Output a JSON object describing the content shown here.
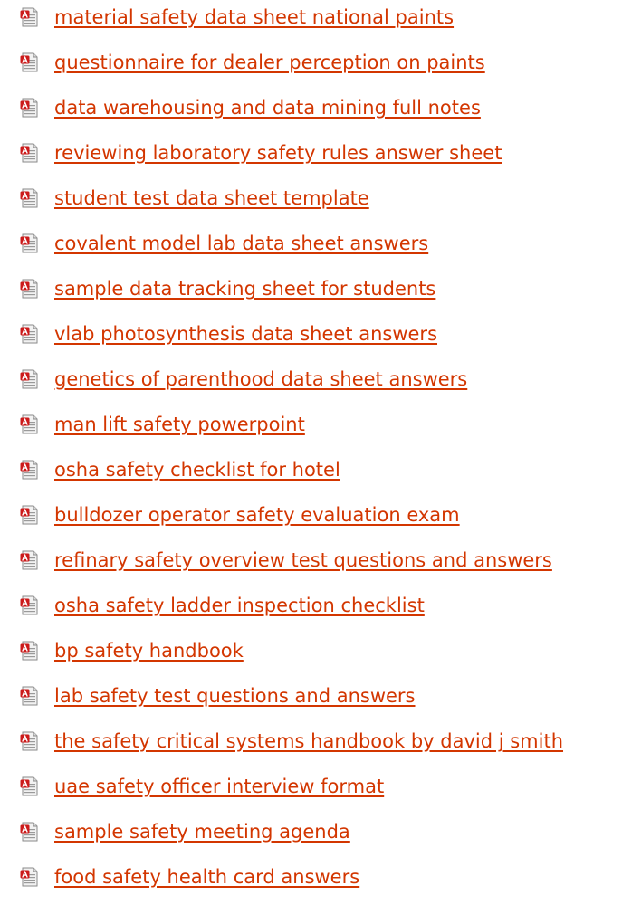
{
  "colors": {
    "link": "#d33600",
    "icon_red": "#cc1b1b",
    "icon_page": "#f2f2f2"
  },
  "icons": {
    "item_icon": "pdf-file-icon"
  },
  "links": [
    {
      "label": "material safety data sheet national paints"
    },
    {
      "label": "questionnaire for dealer perception on paints"
    },
    {
      "label": "data warehousing and data mining full notes"
    },
    {
      "label": "reviewing laboratory safety rules answer sheet"
    },
    {
      "label": "student test data sheet template"
    },
    {
      "label": "covalent model lab data sheet answers"
    },
    {
      "label": "sample data tracking sheet for students"
    },
    {
      "label": "vlab photosynthesis data sheet answers"
    },
    {
      "label": "genetics of parenthood data sheet answers"
    },
    {
      "label": "man lift safety powerpoint"
    },
    {
      "label": "osha safety checklist for hotel"
    },
    {
      "label": "bulldozer operator safety evaluation exam"
    },
    {
      "label": "refinary safety overview test questions and answers"
    },
    {
      "label": "osha safety ladder inspection checklist"
    },
    {
      "label": "bp safety handbook"
    },
    {
      "label": "lab safety test questions and answers"
    },
    {
      "label": "the safety critical systems handbook by david j smith"
    },
    {
      "label": "uae safety officer interview format"
    },
    {
      "label": "sample safety meeting agenda"
    },
    {
      "label": "food safety health card answers"
    }
  ]
}
